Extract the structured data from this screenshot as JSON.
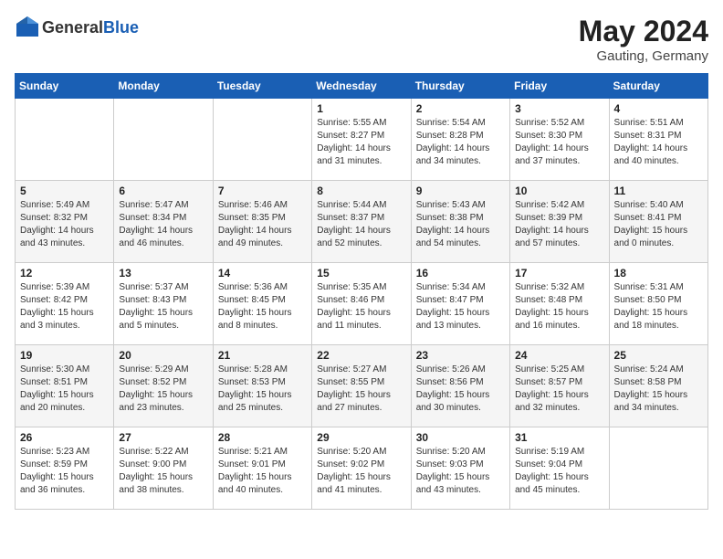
{
  "header": {
    "logo_general": "General",
    "logo_blue": "Blue",
    "month_year": "May 2024",
    "location": "Gauting, Germany"
  },
  "days_of_week": [
    "Sunday",
    "Monday",
    "Tuesday",
    "Wednesday",
    "Thursday",
    "Friday",
    "Saturday"
  ],
  "weeks": [
    [
      {
        "day": "",
        "info": ""
      },
      {
        "day": "",
        "info": ""
      },
      {
        "day": "",
        "info": ""
      },
      {
        "day": "1",
        "info": "Sunrise: 5:55 AM\nSunset: 8:27 PM\nDaylight: 14 hours\nand 31 minutes."
      },
      {
        "day": "2",
        "info": "Sunrise: 5:54 AM\nSunset: 8:28 PM\nDaylight: 14 hours\nand 34 minutes."
      },
      {
        "day": "3",
        "info": "Sunrise: 5:52 AM\nSunset: 8:30 PM\nDaylight: 14 hours\nand 37 minutes."
      },
      {
        "day": "4",
        "info": "Sunrise: 5:51 AM\nSunset: 8:31 PM\nDaylight: 14 hours\nand 40 minutes."
      }
    ],
    [
      {
        "day": "5",
        "info": "Sunrise: 5:49 AM\nSunset: 8:32 PM\nDaylight: 14 hours\nand 43 minutes."
      },
      {
        "day": "6",
        "info": "Sunrise: 5:47 AM\nSunset: 8:34 PM\nDaylight: 14 hours\nand 46 minutes."
      },
      {
        "day": "7",
        "info": "Sunrise: 5:46 AM\nSunset: 8:35 PM\nDaylight: 14 hours\nand 49 minutes."
      },
      {
        "day": "8",
        "info": "Sunrise: 5:44 AM\nSunset: 8:37 PM\nDaylight: 14 hours\nand 52 minutes."
      },
      {
        "day": "9",
        "info": "Sunrise: 5:43 AM\nSunset: 8:38 PM\nDaylight: 14 hours\nand 54 minutes."
      },
      {
        "day": "10",
        "info": "Sunrise: 5:42 AM\nSunset: 8:39 PM\nDaylight: 14 hours\nand 57 minutes."
      },
      {
        "day": "11",
        "info": "Sunrise: 5:40 AM\nSunset: 8:41 PM\nDaylight: 15 hours\nand 0 minutes."
      }
    ],
    [
      {
        "day": "12",
        "info": "Sunrise: 5:39 AM\nSunset: 8:42 PM\nDaylight: 15 hours\nand 3 minutes."
      },
      {
        "day": "13",
        "info": "Sunrise: 5:37 AM\nSunset: 8:43 PM\nDaylight: 15 hours\nand 5 minutes."
      },
      {
        "day": "14",
        "info": "Sunrise: 5:36 AM\nSunset: 8:45 PM\nDaylight: 15 hours\nand 8 minutes."
      },
      {
        "day": "15",
        "info": "Sunrise: 5:35 AM\nSunset: 8:46 PM\nDaylight: 15 hours\nand 11 minutes."
      },
      {
        "day": "16",
        "info": "Sunrise: 5:34 AM\nSunset: 8:47 PM\nDaylight: 15 hours\nand 13 minutes."
      },
      {
        "day": "17",
        "info": "Sunrise: 5:32 AM\nSunset: 8:48 PM\nDaylight: 15 hours\nand 16 minutes."
      },
      {
        "day": "18",
        "info": "Sunrise: 5:31 AM\nSunset: 8:50 PM\nDaylight: 15 hours\nand 18 minutes."
      }
    ],
    [
      {
        "day": "19",
        "info": "Sunrise: 5:30 AM\nSunset: 8:51 PM\nDaylight: 15 hours\nand 20 minutes."
      },
      {
        "day": "20",
        "info": "Sunrise: 5:29 AM\nSunset: 8:52 PM\nDaylight: 15 hours\nand 23 minutes."
      },
      {
        "day": "21",
        "info": "Sunrise: 5:28 AM\nSunset: 8:53 PM\nDaylight: 15 hours\nand 25 minutes."
      },
      {
        "day": "22",
        "info": "Sunrise: 5:27 AM\nSunset: 8:55 PM\nDaylight: 15 hours\nand 27 minutes."
      },
      {
        "day": "23",
        "info": "Sunrise: 5:26 AM\nSunset: 8:56 PM\nDaylight: 15 hours\nand 30 minutes."
      },
      {
        "day": "24",
        "info": "Sunrise: 5:25 AM\nSunset: 8:57 PM\nDaylight: 15 hours\nand 32 minutes."
      },
      {
        "day": "25",
        "info": "Sunrise: 5:24 AM\nSunset: 8:58 PM\nDaylight: 15 hours\nand 34 minutes."
      }
    ],
    [
      {
        "day": "26",
        "info": "Sunrise: 5:23 AM\nSunset: 8:59 PM\nDaylight: 15 hours\nand 36 minutes."
      },
      {
        "day": "27",
        "info": "Sunrise: 5:22 AM\nSunset: 9:00 PM\nDaylight: 15 hours\nand 38 minutes."
      },
      {
        "day": "28",
        "info": "Sunrise: 5:21 AM\nSunset: 9:01 PM\nDaylight: 15 hours\nand 40 minutes."
      },
      {
        "day": "29",
        "info": "Sunrise: 5:20 AM\nSunset: 9:02 PM\nDaylight: 15 hours\nand 41 minutes."
      },
      {
        "day": "30",
        "info": "Sunrise: 5:20 AM\nSunset: 9:03 PM\nDaylight: 15 hours\nand 43 minutes."
      },
      {
        "day": "31",
        "info": "Sunrise: 5:19 AM\nSunset: 9:04 PM\nDaylight: 15 hours\nand 45 minutes."
      },
      {
        "day": "",
        "info": ""
      }
    ]
  ]
}
